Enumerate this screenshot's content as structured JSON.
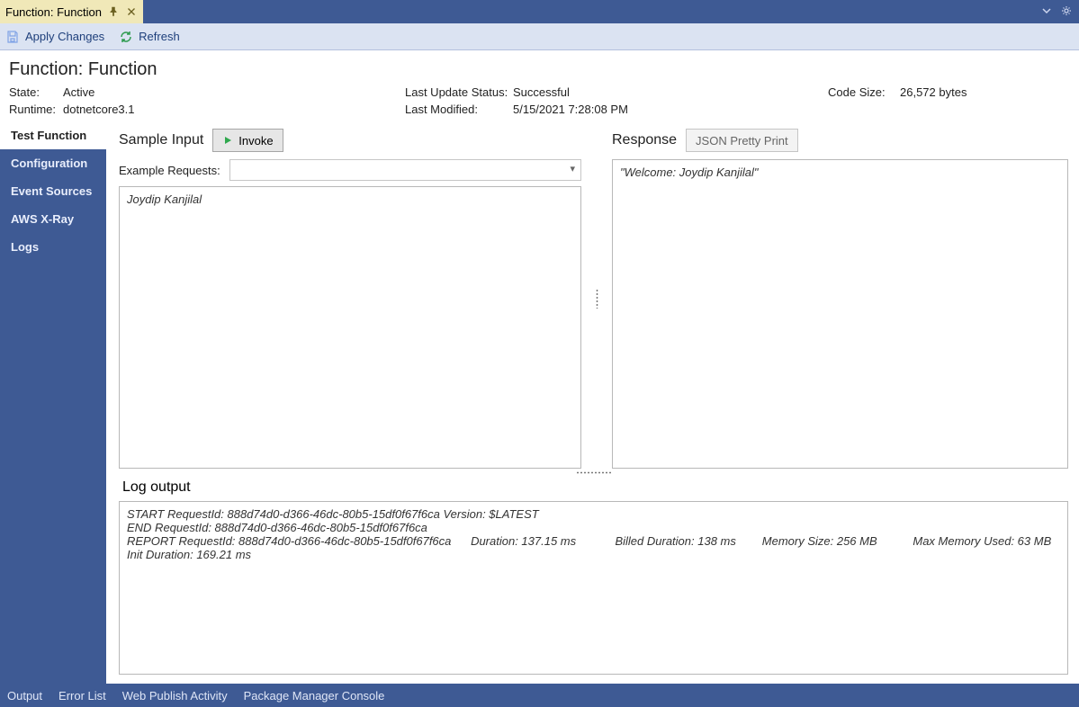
{
  "tab": {
    "title": "Function: Function"
  },
  "toolbar": {
    "apply": "Apply Changes",
    "refresh": "Refresh"
  },
  "header": {
    "title": "Function: Function",
    "state_label": "State:",
    "state": "Active",
    "runtime_label": "Runtime:",
    "runtime": "dotnetcore3.1",
    "last_update_status_label": "Last Update Status:",
    "last_update_status": "Successful",
    "last_modified_label": "Last Modified:",
    "last_modified": "5/15/2021 7:28:08 PM",
    "code_size_label": "Code Size:",
    "code_size": "26,572 bytes"
  },
  "sidebar": {
    "items": [
      {
        "label": "Test Function"
      },
      {
        "label": "Configuration"
      },
      {
        "label": "Event Sources"
      },
      {
        "label": "AWS X-Ray"
      },
      {
        "label": "Logs"
      }
    ]
  },
  "input_panel": {
    "title": "Sample Input",
    "invoke": "Invoke",
    "example_label": "Example Requests:",
    "example_value": "",
    "body": "Joydip Kanjilal"
  },
  "response_panel": {
    "title": "Response",
    "pretty_btn": "JSON Pretty Print",
    "body": "\"Welcome: Joydip Kanjilal\""
  },
  "log": {
    "title": "Log output",
    "body": "START RequestId: 888d74d0-d366-46dc-80b5-15df0f67f6ca Version: $LATEST\nEND RequestId: 888d74d0-d366-46dc-80b5-15df0f67f6ca\nREPORT RequestId: 888d74d0-d366-46dc-80b5-15df0f67f6ca      Duration: 137.15 ms            Billed Duration: 138 ms        Memory Size: 256 MB           Max Memory Used: 63 MB   Init Duration: 169.21 ms"
  },
  "footer": {
    "items": [
      "Output",
      "Error List",
      "Web Publish Activity",
      "Package Manager Console"
    ]
  }
}
